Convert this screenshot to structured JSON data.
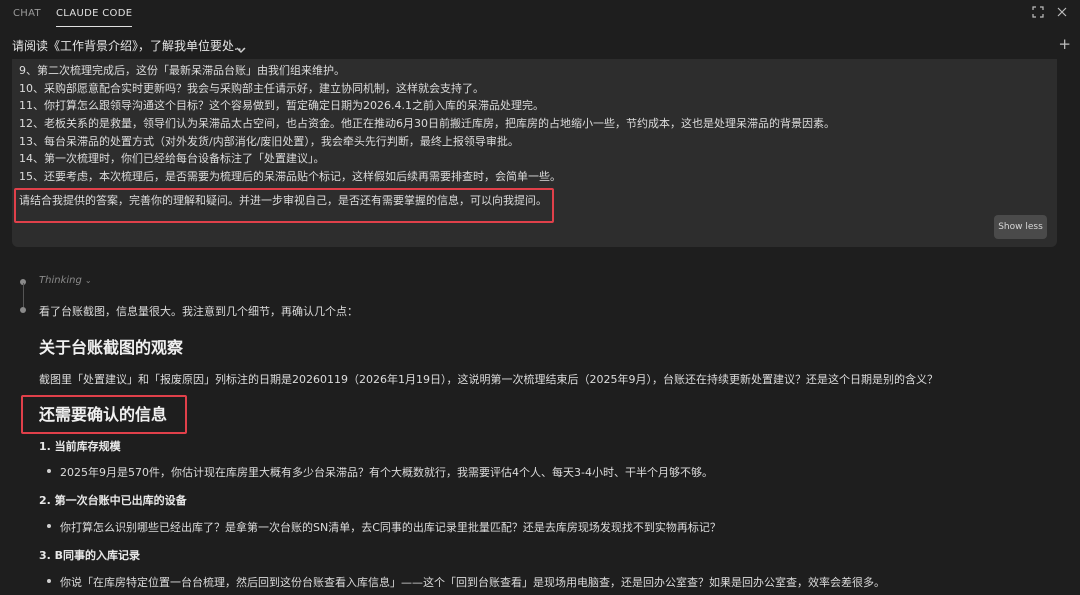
{
  "tabs": {
    "chat": "CHAT",
    "claude_code": "CLAUDE CODE"
  },
  "conversation": {
    "title": "请阅读《工作背景介绍》，了解我单位要处...",
    "new_icon": "+"
  },
  "user_message": {
    "lines": [
      "9、第二次梳理完成后，这份「最新呆滞品台账」由我们组来维护。",
      "10、采购部愿意配合实时更新吗？我会与采购部主任请示好，建立协同机制，这样就会支持了。",
      "11、你打算怎么跟领导沟通这个目标？这个容易做到，暂定确定日期为2026.4.1之前入库的呆滞品处理完。",
      "12、老板关系的是救量，领导们认为呆滞品太占空间，也占资金。他正在推动6月30日前搬迁库房，把库房的占地缩小一些，节约成本，这也是处理呆滞品的背景因素。",
      "13、每台呆滞品的处置方式（对外发货/内部消化/废旧处置），我会牵头先行判断，最终上报领导审批。",
      "14、第一次梳理时，你们已经给每台设备标注了「处置建议」。",
      "15、还要考虑，本次梳理后，是否需要为梳理后的呆滞品贴个标记，这样假如后续再需要排查时，会简单一些。"
    ],
    "request": "请结合我提供的答案，完善你的理解和疑问。并进一步审视自己，是否还有需要掌握的信息，可以向我提问。",
    "show_less": "Show less"
  },
  "response": {
    "thinking": "Thinking",
    "intro": "看了台账截图，信息量很大。我注意到几个细节，再确认几个点：",
    "h_observation": "关于台账截图的观察",
    "p_observation": "截图里「处置建议」和「报废原因」列标注的日期是20260119（2026年1月19日），这说明第一次梳理结束后（2025年9月），台账还在持续更新处置建议？还是这个日期是别的含义？",
    "h_need": "还需要确认的信息",
    "q1_title": "1. 当前库存规模",
    "q1_bullet": "2025年9月是570件，你估计现在库房里大概有多少台呆滞品？有个大概数就行，我需要评估4个人、每天3-4小时、干半个月够不够。",
    "q2_title": "2. 第一次台账中已出库的设备",
    "q2_bullet": "你打算怎么识别哪些已经出库了？是拿第一次台账的SN清单，去C同事的出库记录里批量匹配？还是去库房现场发现找不到实物再标记？",
    "q3_title": "3. B同事的入库记录",
    "q3_bullet": "你说「在库房特定位置一台台梳理，然后回到这份台账查看入库信息」——这个「回到台账查看」是现场用电脑查，还是回办公室查？如果是回办公室查，效率会差很多。"
  },
  "colors": {
    "background": "#1e1e1e",
    "user_bubble": "#2d2d2d",
    "highlight_box": "#e0404a"
  },
  "icons": [
    "expand-icon",
    "close-icon",
    "chevron-down-icon",
    "plus-icon"
  ]
}
